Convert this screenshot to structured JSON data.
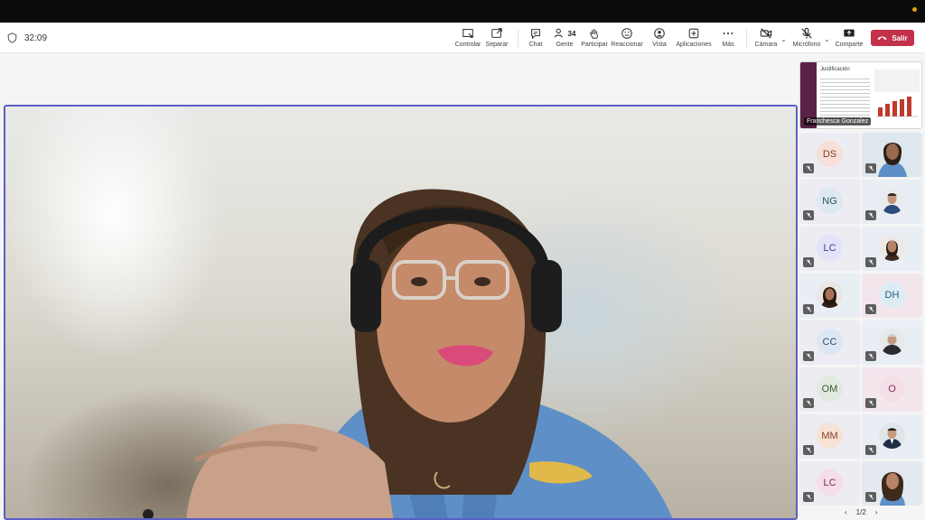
{
  "meeting": {
    "timer": "32:09",
    "leave_label": "Salir",
    "leave_color": "#c4314b",
    "accent": "#5b5fc7"
  },
  "toolbar": {
    "controlar": "Controlar",
    "separar": "Separar",
    "chat": "Chat",
    "gente": "Gente",
    "gente_count": "34",
    "participar": "Participar",
    "reaccionar": "Reaccionar",
    "vista": "Vista",
    "aplicaciones": "Aplicaciones",
    "mas": "Más",
    "camara": "Cámara",
    "microfono": "Micrófono",
    "comparte": "Comparte"
  },
  "shared_screen": {
    "presenter": "Franchesca Gonzalez",
    "slide_title": "Justificación"
  },
  "participants": [
    {
      "initials": "DS",
      "avatar_color": "#f6e0d7",
      "text_color": "#8a3b1f",
      "muted": true
    },
    {
      "initials": "",
      "photo": "photo-icon",
      "muted": true
    },
    {
      "initials": "NG",
      "avatar_color": "#dde9f0",
      "text_color": "#2c4f63",
      "muted": true
    },
    {
      "initials": "",
      "photo": "photo-icon",
      "muted": true
    },
    {
      "initials": "LC",
      "avatar_color": "#e3e4f7",
      "text_color": "#3b3d8a",
      "muted": true
    },
    {
      "initials": "",
      "photo": "photo-icon",
      "muted": true
    },
    {
      "initials": "",
      "photo": "photo-icon",
      "muted": true
    },
    {
      "initials": "DH",
      "avatar_color": "#dcecf5",
      "text_color": "#245b78",
      "muted": true
    },
    {
      "initials": "CC",
      "avatar_color": "#dde6f3",
      "text_color": "#2a4e78",
      "muted": true
    },
    {
      "initials": "",
      "photo": "photo-icon",
      "muted": true
    },
    {
      "initials": "OM",
      "avatar_color": "#e2eadf",
      "text_color": "#3e5a35",
      "muted": true
    },
    {
      "initials": "O",
      "avatar_color": "#f4dfe8",
      "text_color": "#8a2c56",
      "muted": true
    },
    {
      "initials": "MM",
      "avatar_color": "#f7e2d6",
      "text_color": "#8a4320",
      "muted": true
    },
    {
      "initials": "",
      "photo": "photo-icon",
      "muted": true
    },
    {
      "initials": "LC",
      "avatar_color": "#f5dde9",
      "text_color": "#7f2a58",
      "muted": true
    },
    {
      "initials": "",
      "photo": "photo-icon",
      "muted": true
    }
  ],
  "pager": {
    "label": "1/2",
    "prev": "‹",
    "next": "›"
  }
}
